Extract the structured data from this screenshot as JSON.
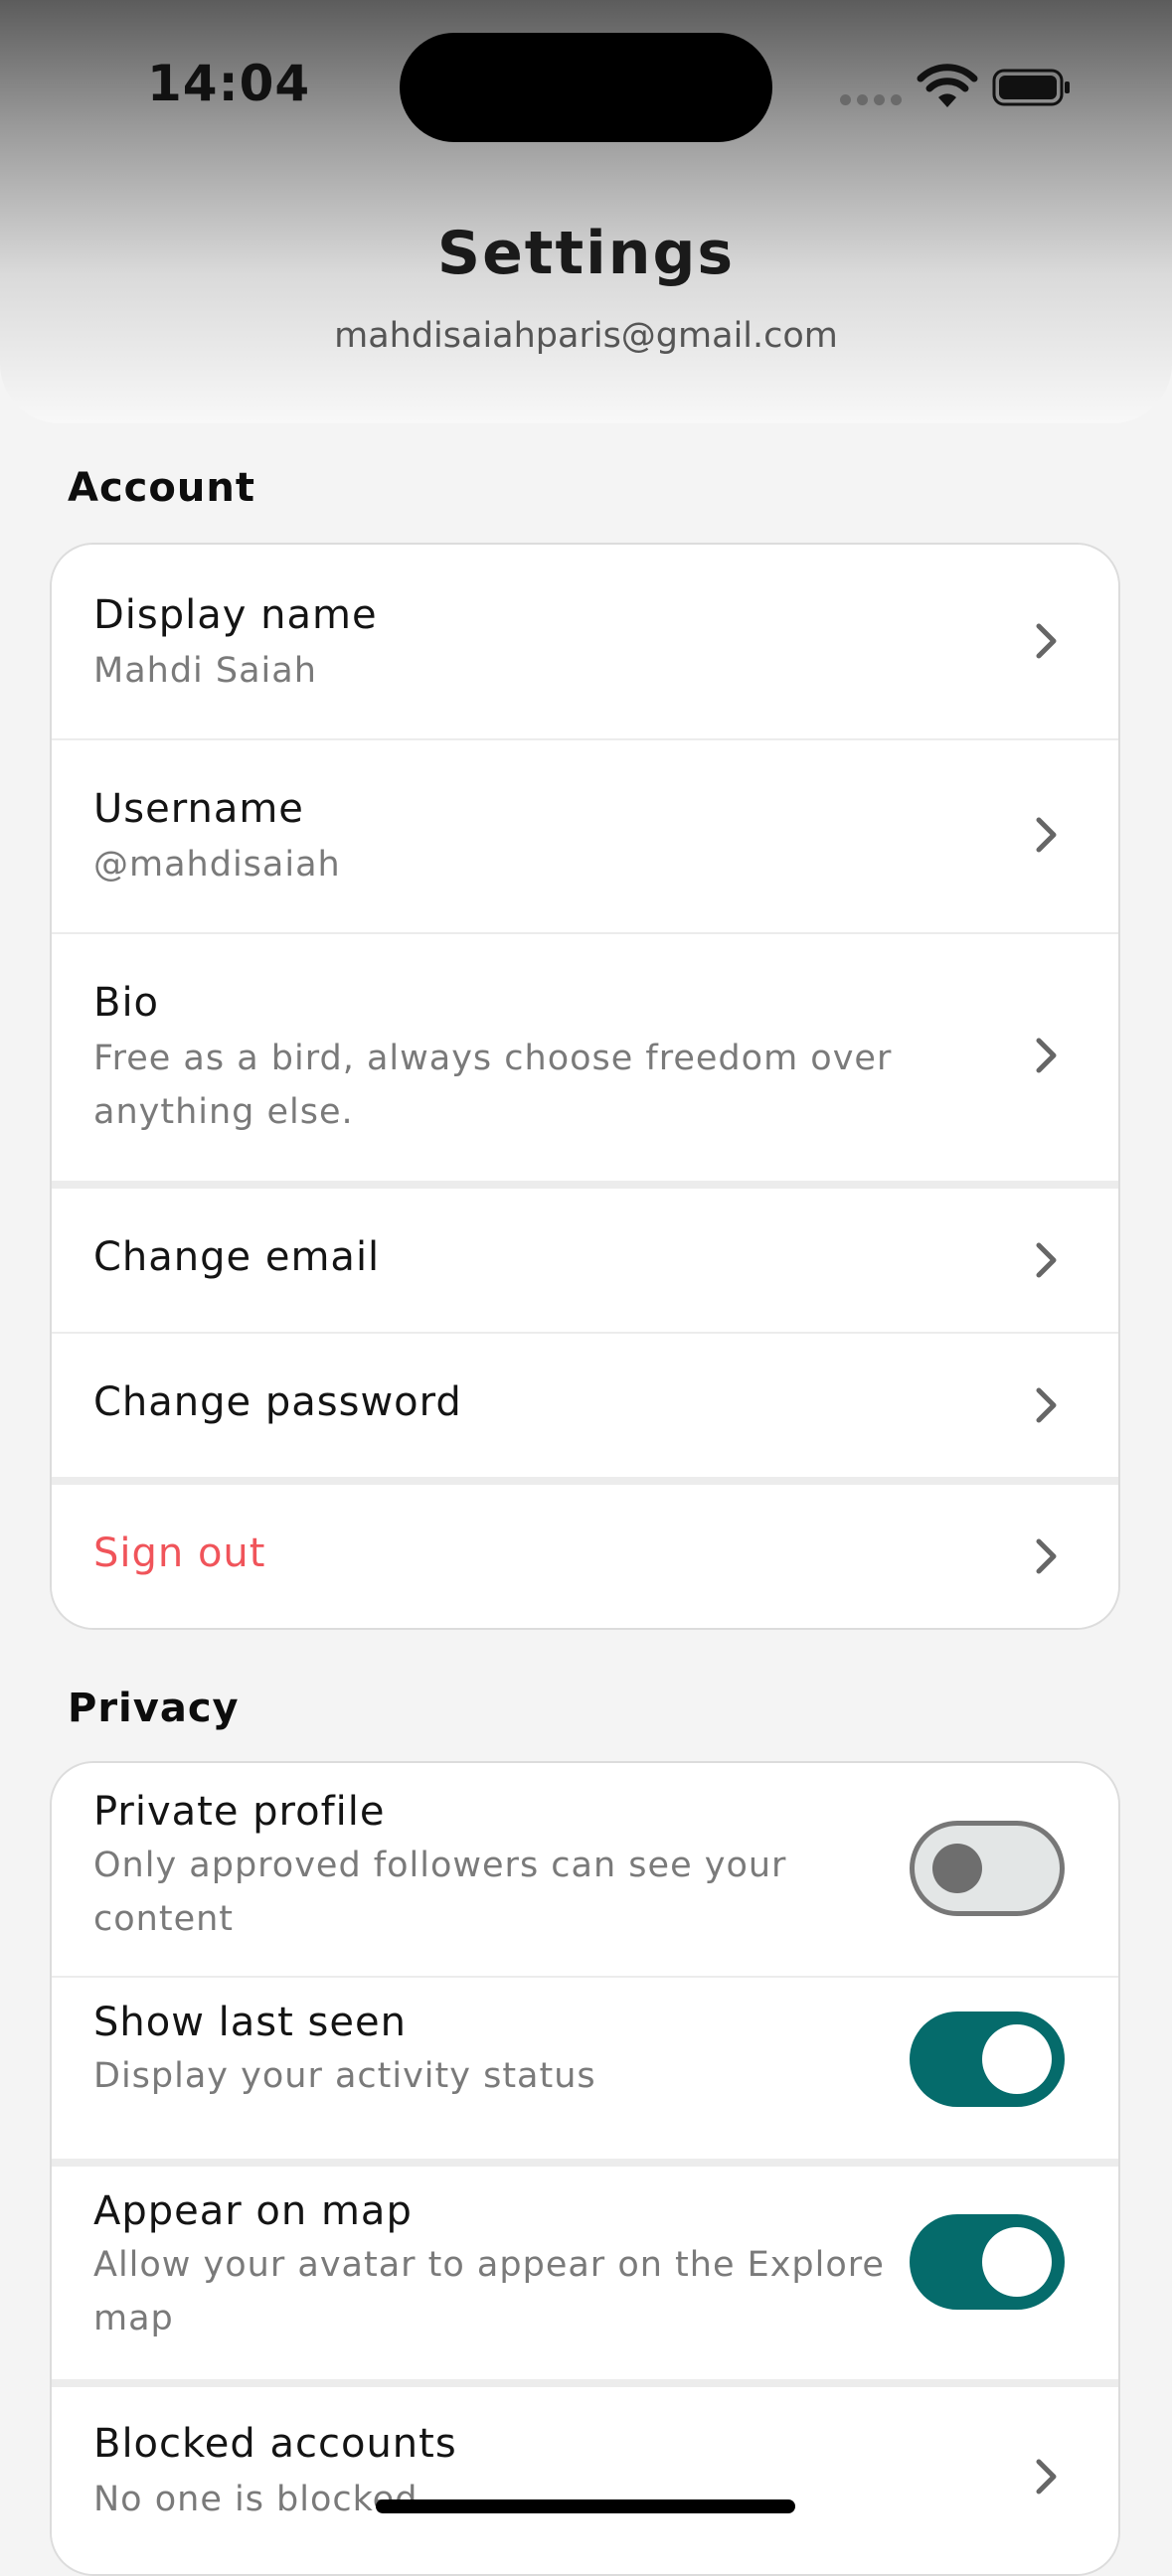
{
  "status_bar": {
    "time": "14:04"
  },
  "header": {
    "title": "Settings",
    "email": "mahdisaiahparis@gmail.com"
  },
  "account": {
    "label": "Account",
    "display_name": {
      "title": "Display name",
      "value": "Mahdi Saiah"
    },
    "username": {
      "title": "Username",
      "value": "@mahdisaiah"
    },
    "bio": {
      "title": "Bio",
      "value": "Free as a bird, always choose freedom over anything else."
    },
    "change_email": {
      "title": "Change email"
    },
    "change_password": {
      "title": "Change password"
    },
    "sign_out": {
      "title": "Sign out",
      "color": "#f0545a"
    }
  },
  "privacy": {
    "label": "Privacy",
    "private_profile": {
      "title": "Private profile",
      "description": "Only approved followers can see your content",
      "enabled": false
    },
    "show_last_seen": {
      "title": "Show last seen",
      "description": "Display your activity status",
      "enabled": true
    },
    "appear_on_map": {
      "title": "Appear on map",
      "description": "Allow your avatar to appear on the Explore map",
      "enabled": true
    },
    "blocked_accounts": {
      "title": "Blocked accounts",
      "description": "No one is blocked"
    }
  },
  "colors": {
    "accent": "#056b6b",
    "danger": "#f0545a"
  }
}
